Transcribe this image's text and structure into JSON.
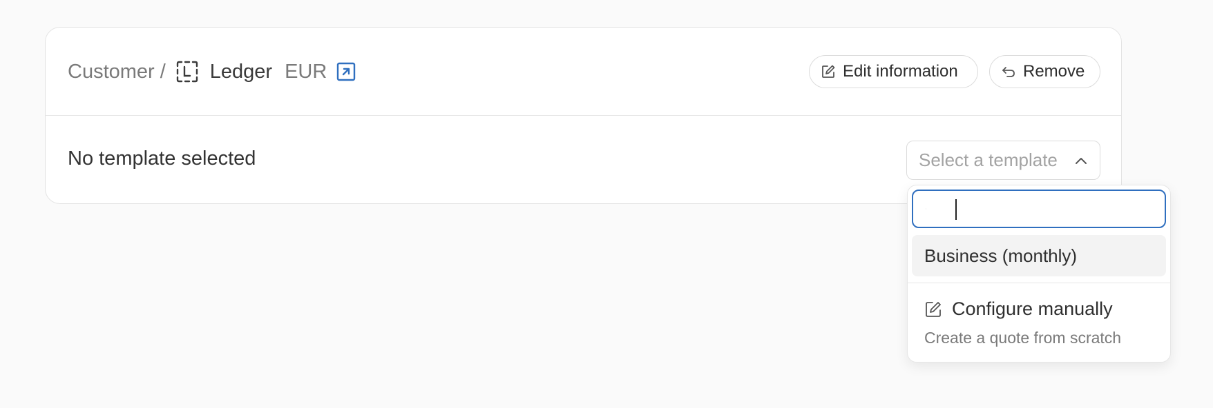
{
  "breadcrumb": {
    "parent": "Customer",
    "separator": "/",
    "current": "Ledger",
    "currency": "EUR"
  },
  "actions": {
    "edit_label": "Edit information",
    "remove_label": "Remove"
  },
  "template": {
    "status": "No template selected",
    "select_placeholder": "Select a template"
  },
  "dropdown": {
    "search_value": "",
    "options": [
      {
        "label": "Business (monthly)"
      }
    ],
    "manual": {
      "title": "Configure manually",
      "description": "Create a quote from scratch"
    }
  },
  "colors": {
    "accent": "#2f6fbf",
    "background": "#fafafa",
    "card": "#ffffff"
  },
  "icons": [
    "ledger-icon",
    "external-link-icon",
    "edit-icon",
    "undo-icon",
    "chevron-up-icon",
    "search-icon"
  ]
}
